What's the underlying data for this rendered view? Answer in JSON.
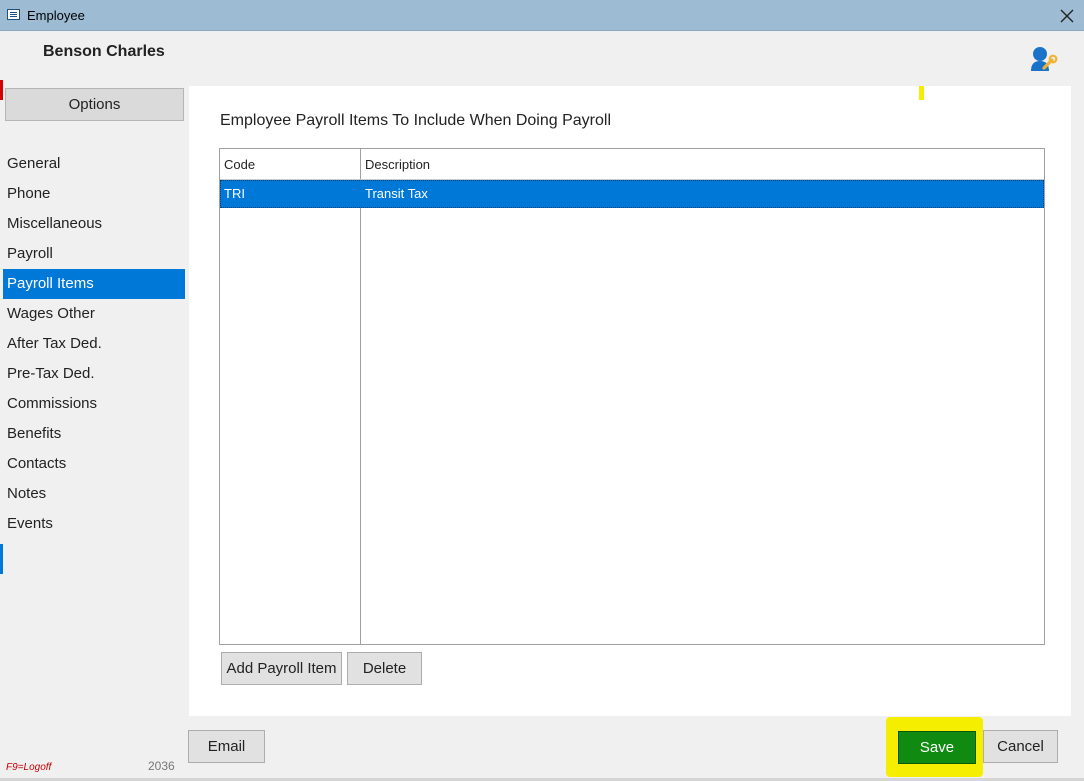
{
  "window": {
    "title": "Employee",
    "close_icon": "close-icon"
  },
  "header": {
    "employee_name": "Benson Charles",
    "icon": "user-tool-icon"
  },
  "sidebar": {
    "options_label": "Options",
    "items": [
      {
        "label": "General",
        "active": false
      },
      {
        "label": "Phone",
        "active": false
      },
      {
        "label": "Miscellaneous",
        "active": false
      },
      {
        "label": "Payroll",
        "active": false
      },
      {
        "label": "Payroll Items",
        "active": true
      },
      {
        "label": "Wages Other",
        "active": false
      },
      {
        "label": "After Tax Ded.",
        "active": false
      },
      {
        "label": "Pre-Tax Ded.",
        "active": false
      },
      {
        "label": "Commissions",
        "active": false
      },
      {
        "label": "Benefits",
        "active": false
      },
      {
        "label": "Contacts",
        "active": false
      },
      {
        "label": "Notes",
        "active": false
      },
      {
        "label": "Events",
        "active": false
      }
    ]
  },
  "main": {
    "title": "Employee Payroll Items To Include When Doing Payroll",
    "table": {
      "columns": [
        "Code",
        "Description"
      ],
      "rows": [
        {
          "code": "TRI",
          "description": "Transit Tax",
          "selected": true
        }
      ]
    },
    "add_button": "Add Payroll Item",
    "delete_button": "Delete"
  },
  "footer": {
    "email_button": "Email",
    "save_button": "Save",
    "cancel_button": "Cancel",
    "logoff_hint": "F9=Logoff",
    "code_number": "2036"
  },
  "colors": {
    "accent": "#0078d7",
    "save_green": "#108a10",
    "highlight_yellow": "#f5ee00",
    "titlebar": "#9dbbd3"
  }
}
